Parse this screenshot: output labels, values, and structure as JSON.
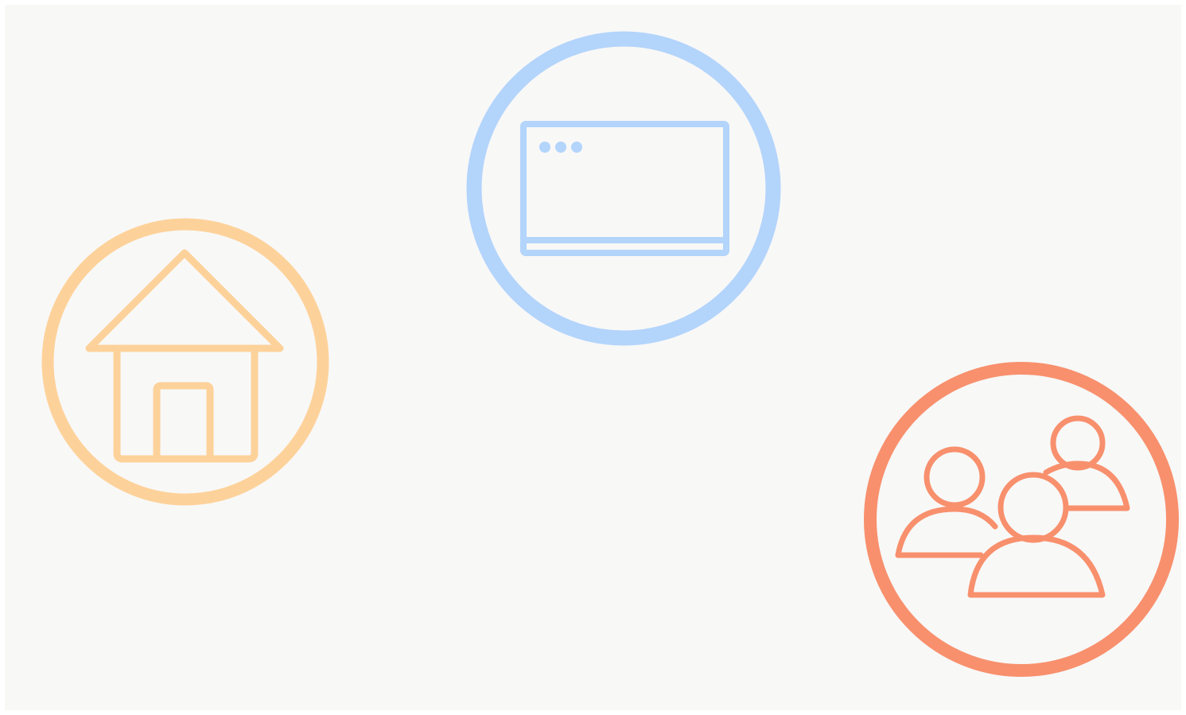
{
  "badges": [
    {
      "icon": "house-icon",
      "color": "#fdd29a"
    },
    {
      "icon": "browser-window-icon",
      "color": "#b3d4fb"
    },
    {
      "icon": "people-group-icon",
      "color": "#f8906d"
    }
  ]
}
